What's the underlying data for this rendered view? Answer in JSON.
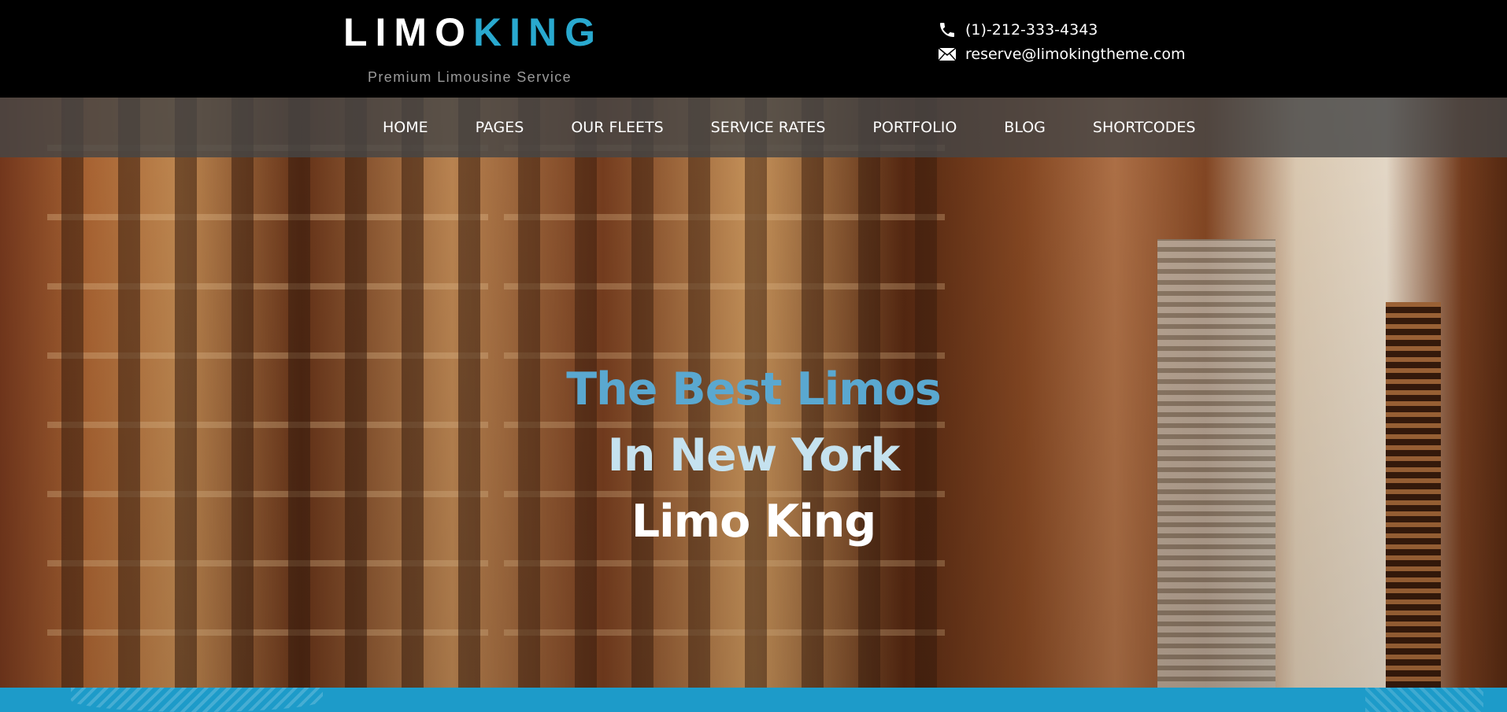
{
  "brand": {
    "logo_word_1": "LIMO",
    "logo_word_2": "KING",
    "tagline": "Premium Limousine Service"
  },
  "contact": {
    "phone": "(1)-212-333-4343",
    "email": "reserve@limokingtheme.com",
    "phone_icon": "phone-icon",
    "email_icon": "envelope-icon"
  },
  "nav": {
    "items": [
      {
        "label": "HOME"
      },
      {
        "label": "PAGES"
      },
      {
        "label": "OUR FLEETS"
      },
      {
        "label": "SERVICE RATES"
      },
      {
        "label": "PORTFOLIO"
      },
      {
        "label": "BLOG"
      },
      {
        "label": "SHORTCODES"
      }
    ]
  },
  "hero": {
    "line_1": "The Best Limos",
    "line_2": "In New York",
    "line_3": "Limo King"
  },
  "colors": {
    "accent": "#29a9cf",
    "header_bg": "#000000",
    "strip": "#1d9bc9"
  }
}
